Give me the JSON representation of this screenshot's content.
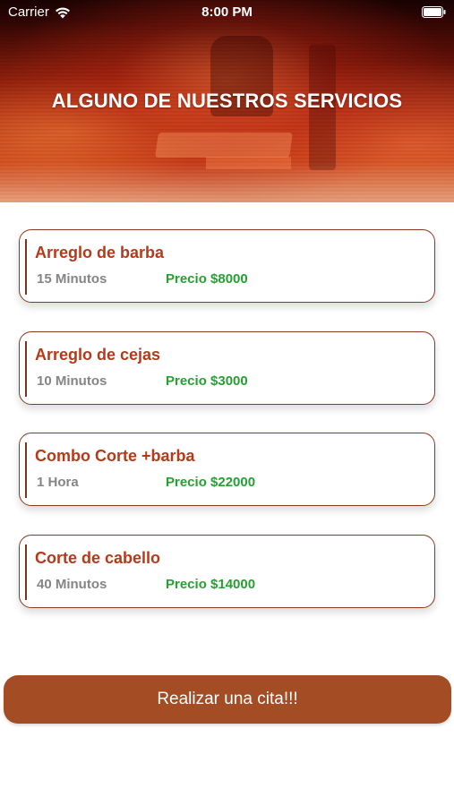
{
  "status_bar": {
    "carrier": "Carrier",
    "time": "8:00 PM",
    "wifi_icon": "wifi-icon",
    "battery_icon": "battery-icon"
  },
  "header": {
    "title": "ALGUNO DE NUESTROS SERVICIOS"
  },
  "services": [
    {
      "name": "Arreglo de barba",
      "duration": "15 Minutos",
      "price": "Precio $8000"
    },
    {
      "name": "Arreglo de cejas",
      "duration": "10 Minutos",
      "price": "Precio $3000"
    },
    {
      "name": "Combo Corte +barba",
      "duration": "1 Hora",
      "price": "Precio $22000"
    },
    {
      "name": "Corte de cabello",
      "duration": "40 Minutos",
      "price": "Precio $14000"
    }
  ],
  "cta": {
    "label": "Realizar una cita!!!"
  },
  "colors": {
    "accent": "#a44c24",
    "service_name": "#b53a1a",
    "price": "#27a033",
    "duration": "#858585",
    "card_border": "#8a3a22"
  }
}
